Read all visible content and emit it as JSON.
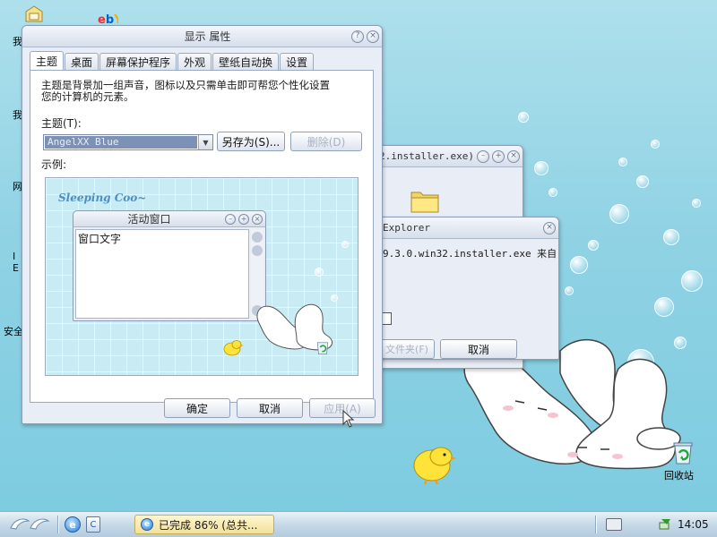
{
  "desktop": {
    "icons_left_labels": [
      "我",
      "我",
      "网",
      "I",
      "E",
      "安全"
    ],
    "recycle_bin_label": "回收站"
  },
  "display_window": {
    "title": "显示 属性",
    "tabs": [
      "主题",
      "桌面",
      "屏幕保护程序",
      "外观",
      "壁纸自动换",
      "设置"
    ],
    "description_line1": "主题是背景加一组声音，图标以及只需单击即可帮您个性化设置",
    "description_line2": "您的计算机的元素。",
    "theme_label": "主题(T):",
    "theme_value": "AngelXX Blue",
    "save_as_button": "另存为(S)...",
    "delete_button": "删除(D)",
    "sample_label": "示例:",
    "preview": {
      "brand": "Sleeping Coo~",
      "active_window_title": "活动窗口",
      "window_text": "窗口文字"
    },
    "ok_button": "确定",
    "cancel_button": "取消",
    "apply_button": "应用(A)"
  },
  "bg_window_1": {
    "title_fragment": "2.installer.exe)"
  },
  "bg_window_2": {
    "title_fragment": "Explorer",
    "message": "9.3.0.win32.installer.exe 来自",
    "folder_button": "文件夹(F)",
    "cancel_button": "取消"
  },
  "taskbar": {
    "task_label": "已完成 86% (总共...",
    "clock": "14:05"
  },
  "colors": {
    "desktop_top": "#aee0ec",
    "desktop_bottom": "#7ccbe0",
    "task_button": "#f6e7a8",
    "selection": "#7d90b5"
  }
}
